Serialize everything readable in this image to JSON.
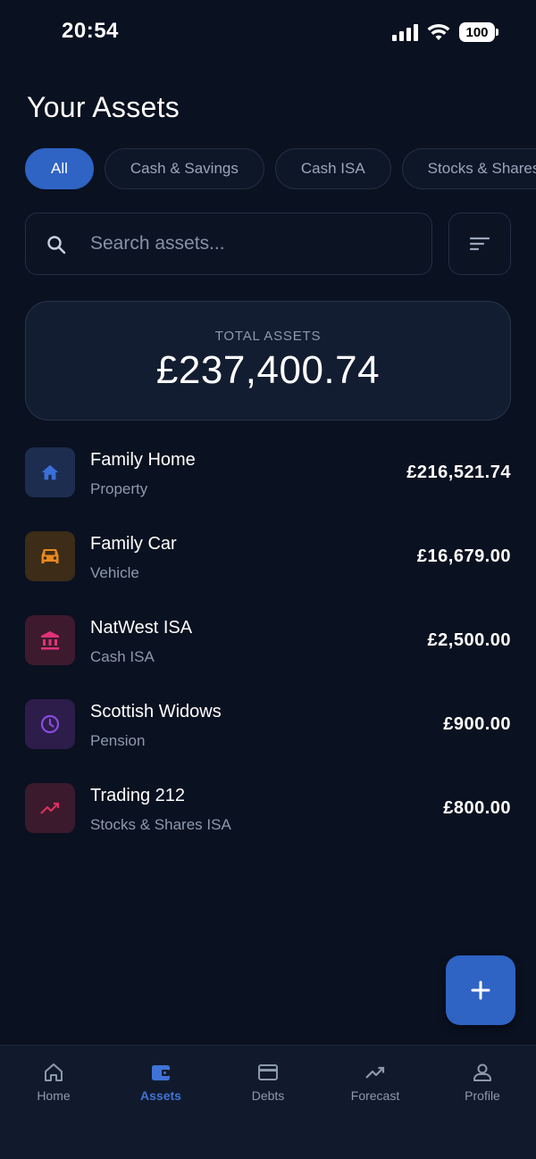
{
  "status_bar": {
    "time": "20:54",
    "battery": "100"
  },
  "page": {
    "title": "Your Assets"
  },
  "filters": [
    {
      "label": "All",
      "active": true
    },
    {
      "label": "Cash & Savings",
      "active": false
    },
    {
      "label": "Cash ISA",
      "active": false
    },
    {
      "label": "Stocks & Shares ISA",
      "active": false
    }
  ],
  "search": {
    "placeholder": "Search assets..."
  },
  "total": {
    "label": "TOTAL ASSETS",
    "value": "£237,400.74"
  },
  "assets": [
    {
      "name": "Family Home",
      "type": "Property",
      "value": "£216,521.74",
      "icon": "home-icon",
      "color": "#3a6fd8",
      "bg": "#1d2d50"
    },
    {
      "name": "Family Car",
      "type": "Vehicle",
      "value": "£16,679.00",
      "icon": "car-icon",
      "color": "#e8891e",
      "bg": "#3c2c18"
    },
    {
      "name": "NatWest ISA",
      "type": "Cash ISA",
      "value": "£2,500.00",
      "icon": "bank-icon",
      "color": "#e0327a",
      "bg": "#3e1a2e"
    },
    {
      "name": "Scottish Widows",
      "type": "Pension",
      "value": "£900.00",
      "icon": "clock-icon",
      "color": "#8a4be0",
      "bg": "#2c1d4a"
    },
    {
      "name": "Trading 212",
      "type": "Stocks & Shares ISA",
      "value": "£800.00",
      "icon": "trending-up-icon",
      "color": "#d8305e",
      "bg": "#3a1a2c"
    }
  ],
  "nav": [
    {
      "label": "Home",
      "icon": "home-icon",
      "active": false
    },
    {
      "label": "Assets",
      "icon": "wallet-icon",
      "active": true
    },
    {
      "label": "Debts",
      "icon": "credit-card-icon",
      "active": false
    },
    {
      "label": "Forecast",
      "icon": "trending-up-icon",
      "active": false
    },
    {
      "label": "Profile",
      "icon": "person-icon",
      "active": false
    }
  ],
  "colors": {
    "accent": "#2f63c4",
    "background": "#0a1120",
    "nav_active": "#3f73d6"
  }
}
